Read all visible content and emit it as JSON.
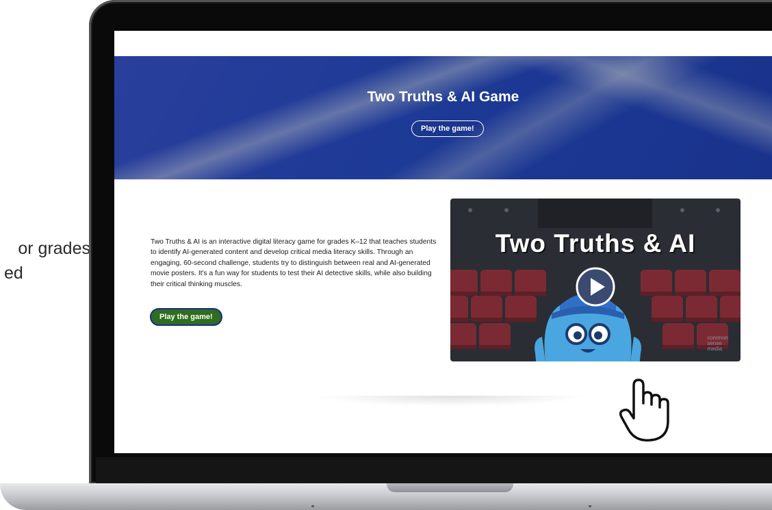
{
  "background_text": {
    "line1": "or grades",
    "line2": "ed"
  },
  "hero": {
    "title": "Two Truths & AI Game",
    "button_label": "Play the game!"
  },
  "content": {
    "description": "Two Truths & AI is an interactive digital literacy game for grades K–12 that teaches students to identify AI-generated content and develop critical media literacy skills. Through an engaging, 60-second challenge, students try to distinguish between real and AI-generated movie posters. It's a fun way for students to test their AI detective skills, while also building their critical thinking muscles.",
    "button_label": "Play the game!"
  },
  "video": {
    "title": "Two Truths & AI",
    "logo_lines": [
      "common",
      "sense",
      "media"
    ]
  },
  "colors": {
    "hero_blue": "#1d3a96",
    "button_green": "#2f6d1f",
    "button_border": "#1e2a8c",
    "video_bg": "#2b2d34",
    "seat_red": "#7b2a33",
    "character_blue": "#4aa6e0"
  },
  "icons": {
    "play": "play-icon",
    "hand_cursor": "hand-pointer-icon",
    "logo": "common-sense-media-logo"
  }
}
